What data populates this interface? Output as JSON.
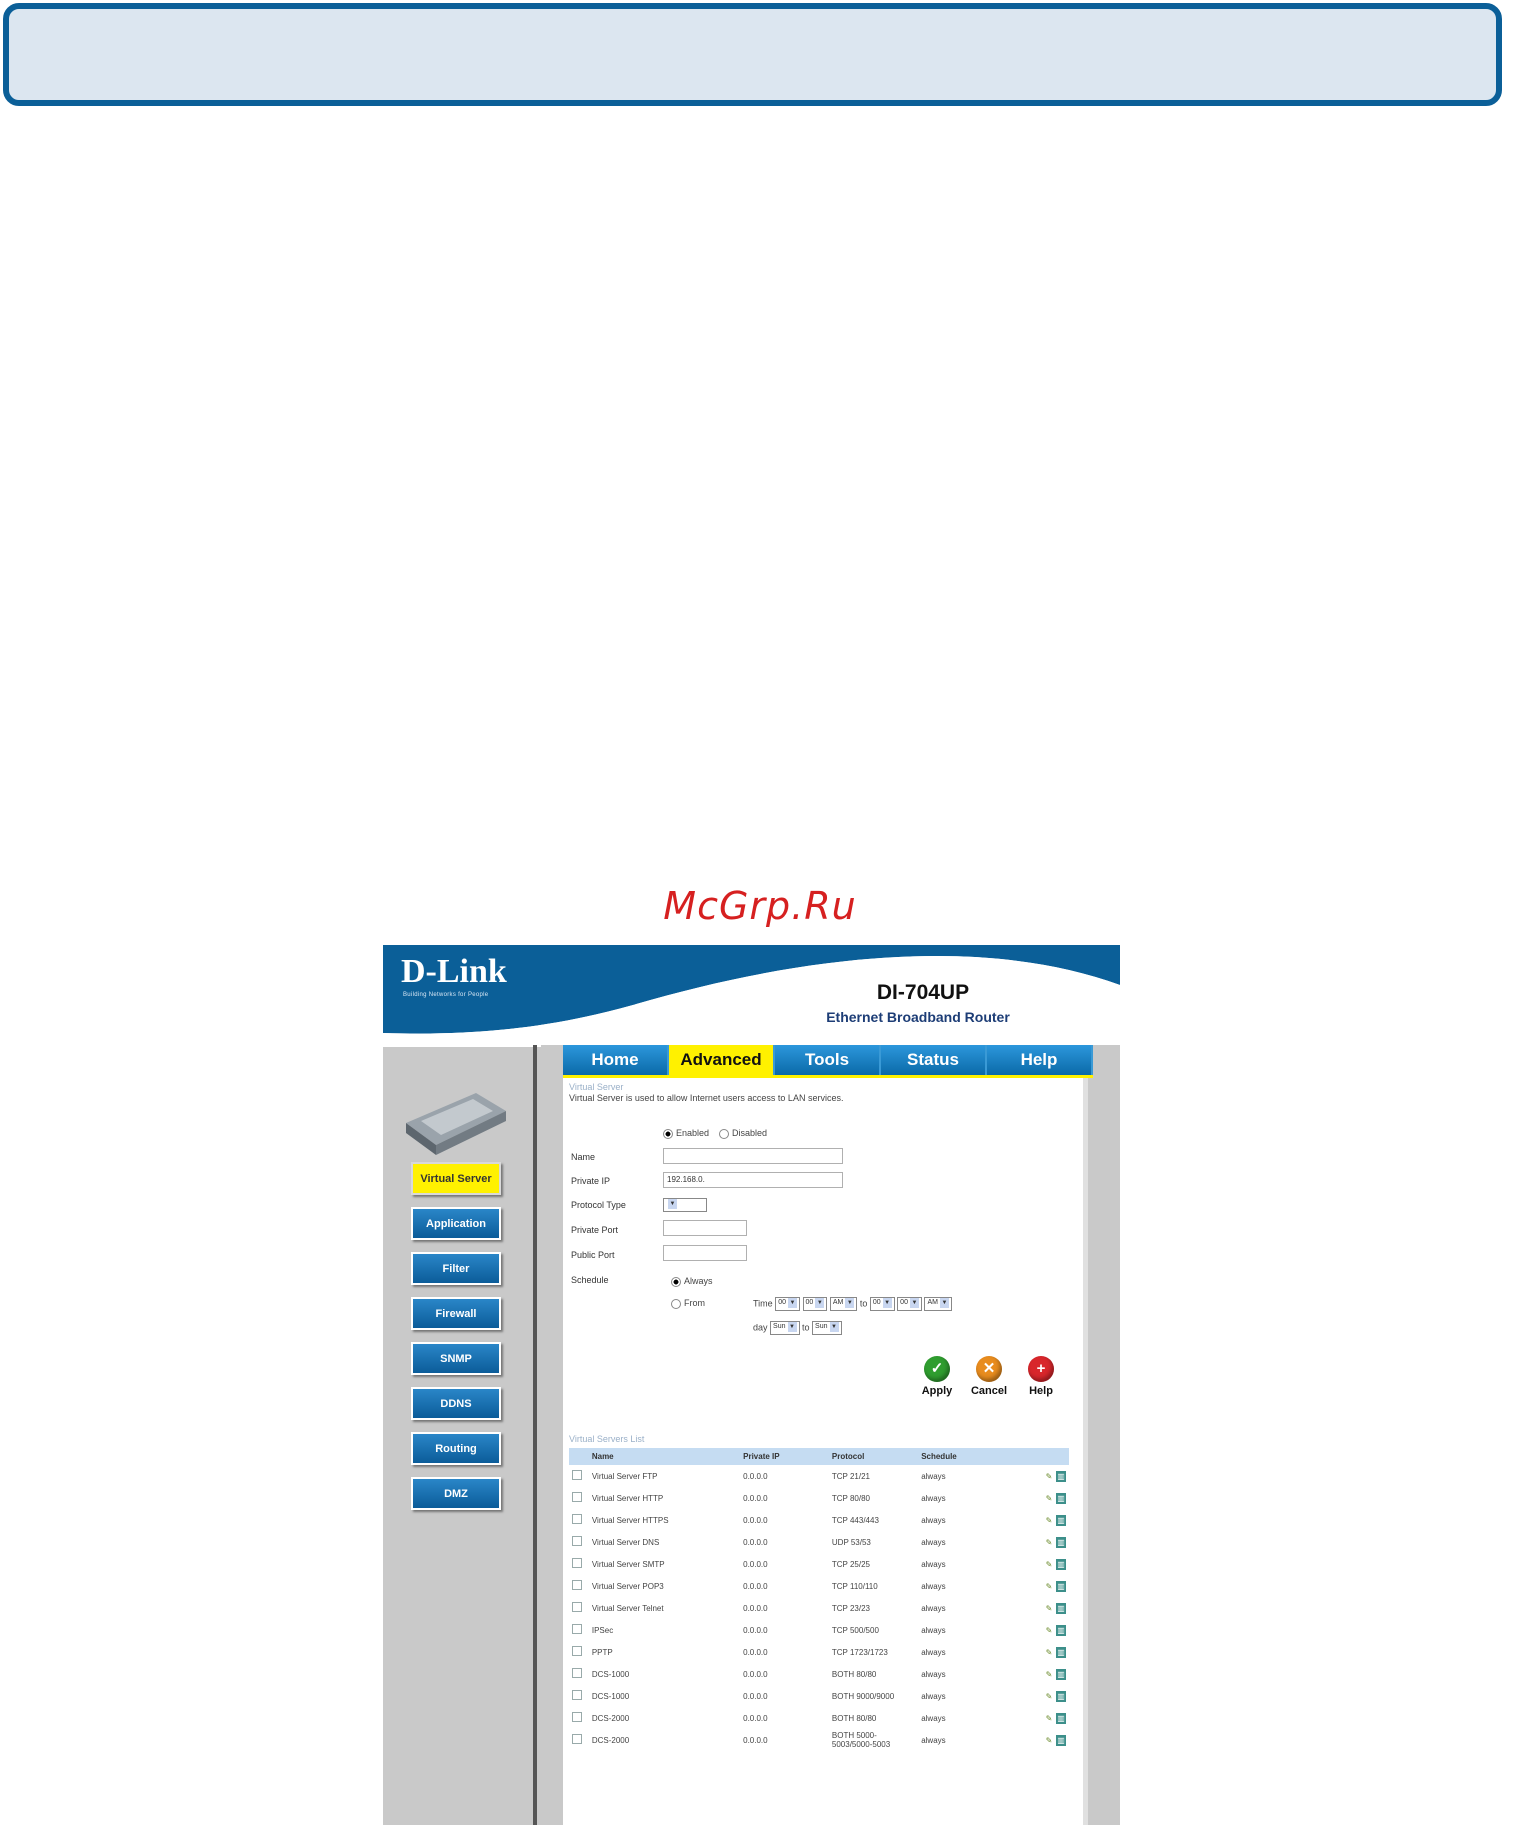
{
  "watermark": "McGrp.Ru",
  "header": {
    "logo": "D-Link",
    "tagline": "Building Networks for People",
    "model": "DI-704UP",
    "subtitle": "Ethernet Broadband Router"
  },
  "tabs": [
    {
      "label": "Home",
      "active": false
    },
    {
      "label": "Advanced",
      "active": true
    },
    {
      "label": "Tools",
      "active": false
    },
    {
      "label": "Status",
      "active": false
    },
    {
      "label": "Help",
      "active": false
    }
  ],
  "sidebar": {
    "items": [
      {
        "label": "Virtual Server",
        "active": true
      },
      {
        "label": "Application",
        "active": false
      },
      {
        "label": "Filter",
        "active": false
      },
      {
        "label": "Firewall",
        "active": false
      },
      {
        "label": "SNMP",
        "active": false
      },
      {
        "label": "DDNS",
        "active": false
      },
      {
        "label": "Routing",
        "active": false
      },
      {
        "label": "DMZ",
        "active": false
      }
    ]
  },
  "form": {
    "section_title": "Virtual Server",
    "description": "Virtual Server is used to allow Internet users access to LAN services.",
    "enabled_label": "Enabled",
    "disabled_label": "Disabled",
    "name_label": "Name",
    "private_ip_label": "Private IP",
    "private_ip_value": "192.168.0.",
    "protocol_type_label": "Protocol Type",
    "private_port_label": "Private Port",
    "public_port_label": "Public Port",
    "schedule_label": "Schedule",
    "always_label": "Always",
    "from_label": "From",
    "time_label": "Time",
    "to_label": "to",
    "day_label": "day",
    "day_from": "Sun",
    "day_to": "Sun",
    "time_values": [
      "00",
      "00",
      "AM",
      "00",
      "00",
      "AM"
    ]
  },
  "actions": {
    "apply": "Apply",
    "cancel": "Cancel",
    "help": "Help"
  },
  "list": {
    "title": "Virtual Servers List",
    "columns": [
      "Name",
      "Private IP",
      "Protocol",
      "Schedule"
    ],
    "rows": [
      {
        "name": "Virtual Server FTP",
        "ip": "0.0.0.0",
        "protocol": "TCP 21/21",
        "schedule": "always"
      },
      {
        "name": "Virtual Server HTTP",
        "ip": "0.0.0.0",
        "protocol": "TCP 80/80",
        "schedule": "always"
      },
      {
        "name": "Virtual Server HTTPS",
        "ip": "0.0.0.0",
        "protocol": "TCP 443/443",
        "schedule": "always"
      },
      {
        "name": "Virtual Server DNS",
        "ip": "0.0.0.0",
        "protocol": "UDP 53/53",
        "schedule": "always"
      },
      {
        "name": "Virtual Server SMTP",
        "ip": "0.0.0.0",
        "protocol": "TCP 25/25",
        "schedule": "always"
      },
      {
        "name": "Virtual Server POP3",
        "ip": "0.0.0.0",
        "protocol": "TCP 110/110",
        "schedule": "always"
      },
      {
        "name": "Virtual Server Telnet",
        "ip": "0.0.0.0",
        "protocol": "TCP 23/23",
        "schedule": "always"
      },
      {
        "name": "IPSec",
        "ip": "0.0.0.0",
        "protocol": "TCP 500/500",
        "schedule": "always"
      },
      {
        "name": "PPTP",
        "ip": "0.0.0.0",
        "protocol": "TCP 1723/1723",
        "schedule": "always"
      },
      {
        "name": "DCS-1000",
        "ip": "0.0.0.0",
        "protocol": "BOTH 80/80",
        "schedule": "always"
      },
      {
        "name": "DCS-1000",
        "ip": "0.0.0.0",
        "protocol": "BOTH 9000/9000",
        "schedule": "always"
      },
      {
        "name": "DCS-2000",
        "ip": "0.0.0.0",
        "protocol": "BOTH 80/80",
        "schedule": "always"
      },
      {
        "name": "DCS-2000",
        "ip": "0.0.0.0",
        "protocol": "BOTH 5000-5003/5000-5003",
        "schedule": "always"
      }
    ]
  },
  "colors": {
    "brand_blue": "#0b5f98",
    "tab_blue": "#0b74b8",
    "highlight_yellow": "#fff100",
    "apply_green": "#2f9d2f",
    "cancel_orange": "#e88c1e",
    "help_red": "#d8262b"
  }
}
